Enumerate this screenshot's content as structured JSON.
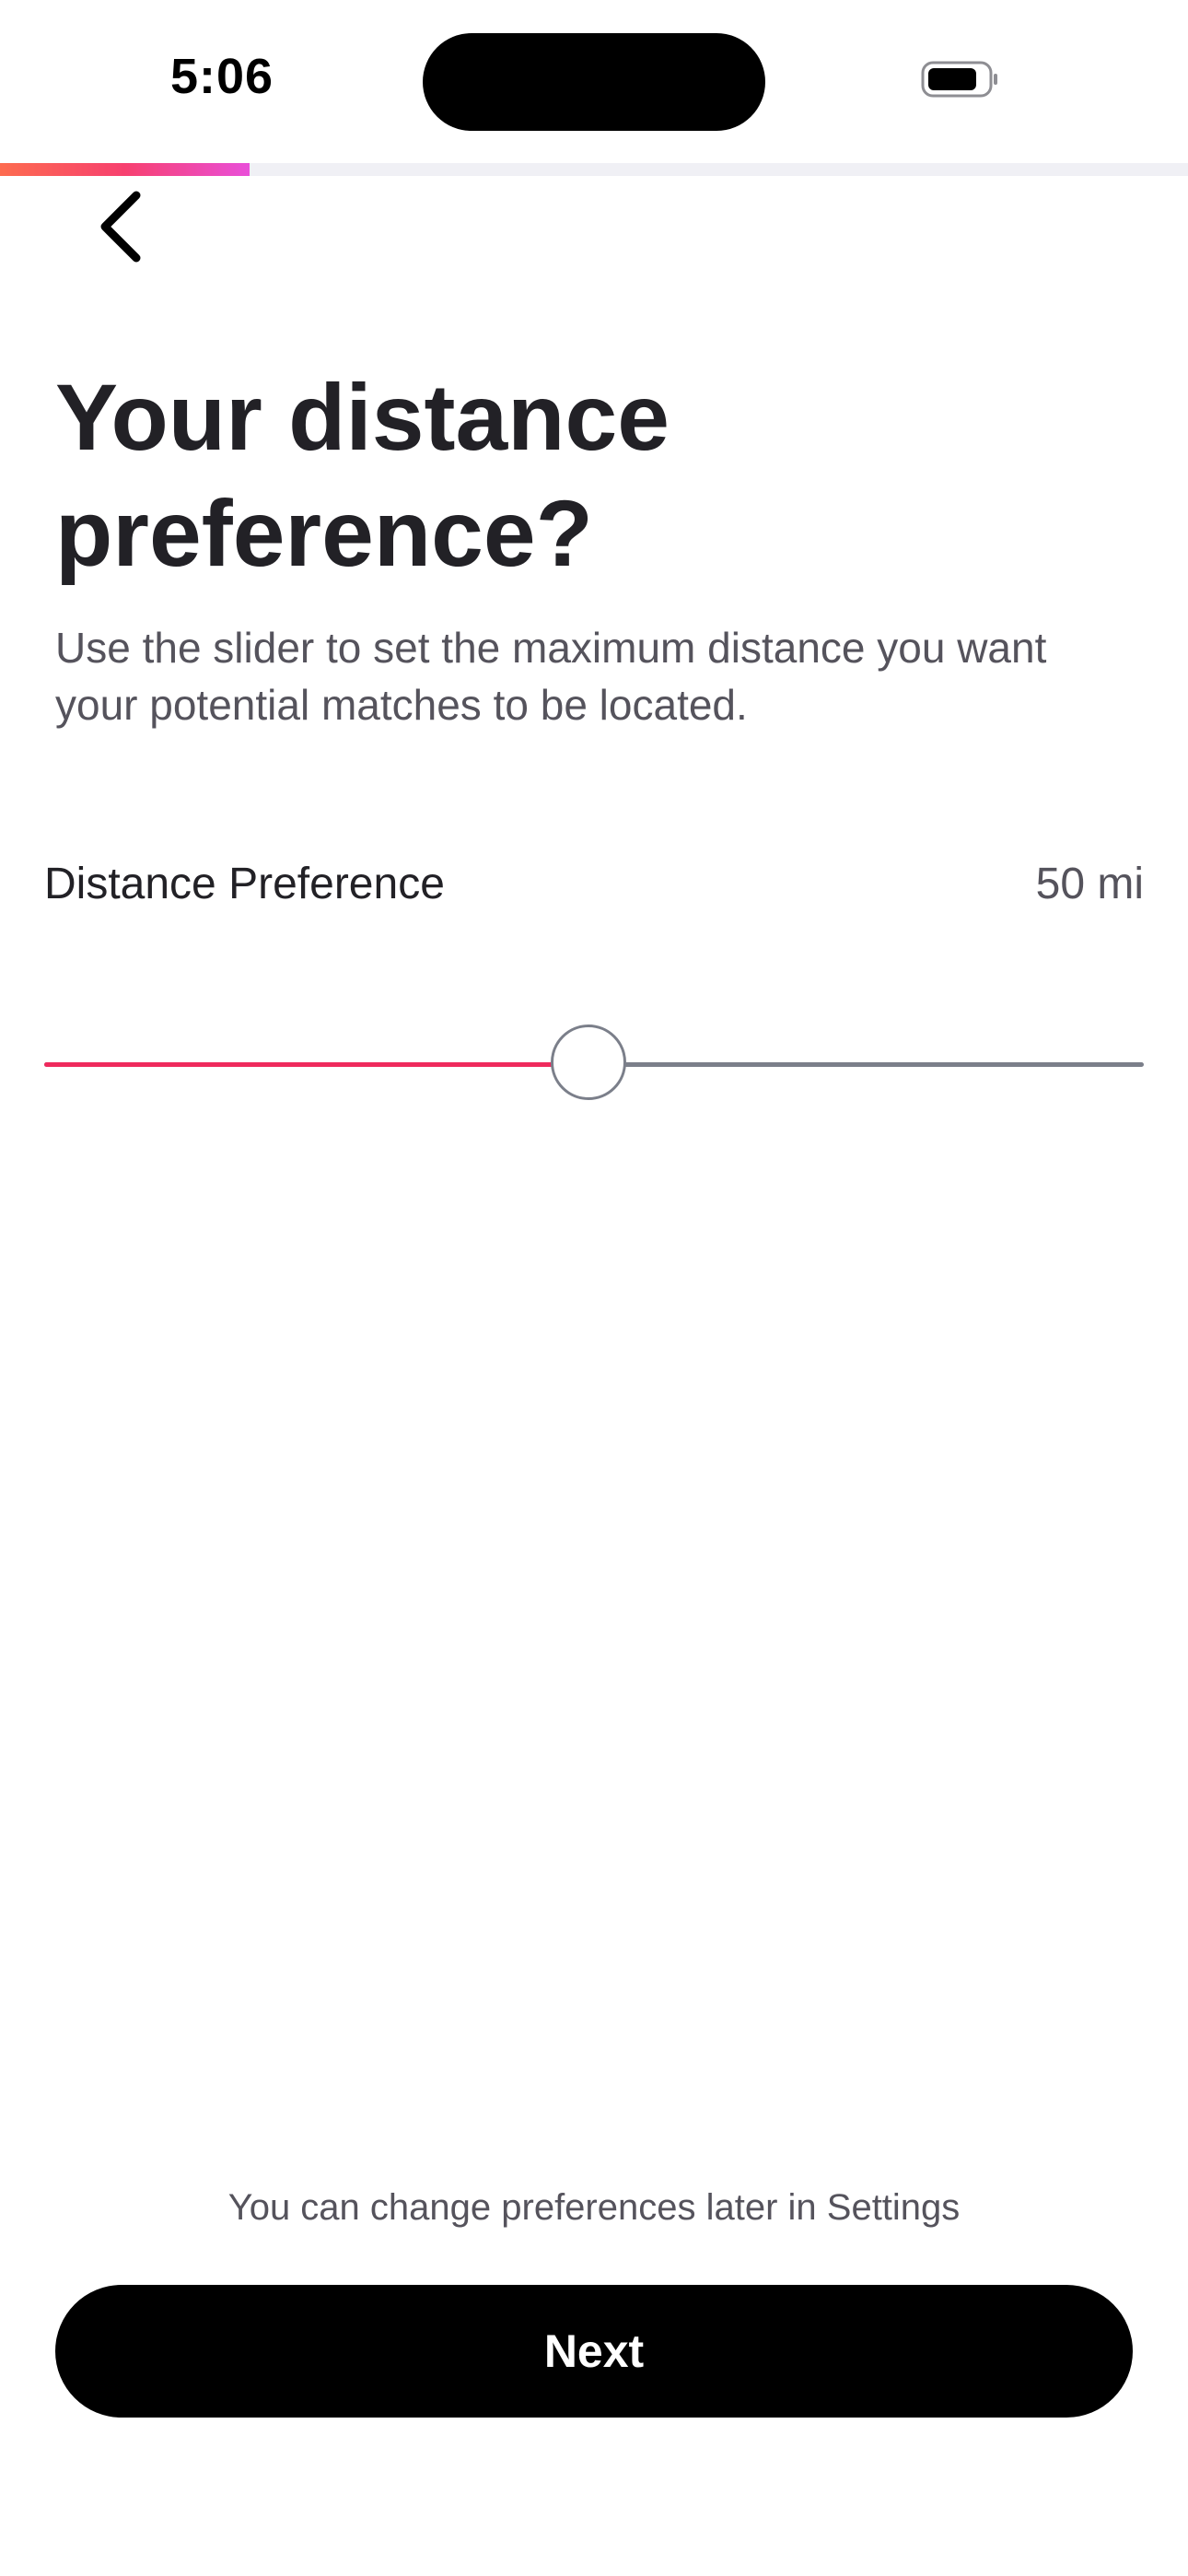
{
  "status_bar": {
    "time": "5:06",
    "battery_icon": "battery-icon"
  },
  "progress": {
    "fraction": 0.21,
    "gradient_colors": [
      "#fd6b4f",
      "#f7406f",
      "#e94fd9"
    ]
  },
  "back_button": {
    "icon": "chevron-left-icon"
  },
  "header": {
    "title": "Your distance preference?",
    "description": "Use the slider to set the maximum distance you want your potential matches to be located."
  },
  "distance": {
    "label": "Distance Preference",
    "value_text": "50 mi",
    "slider_fraction": 0.495,
    "fill_color": "#ef2a5d",
    "track_color": "#7b7f8a"
  },
  "footer": {
    "note": "You can change preferences later in Settings",
    "next_label": "Next"
  }
}
